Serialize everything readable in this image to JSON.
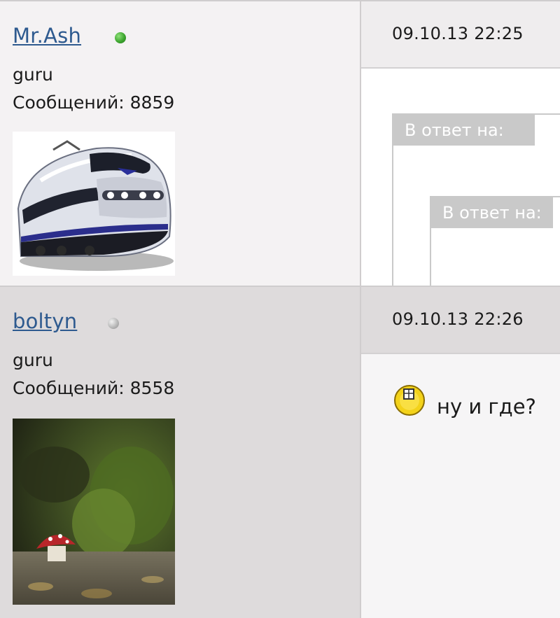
{
  "posts": [
    {
      "username": "Mr.Ash",
      "status": "online",
      "rank": "guru",
      "posts_count": "Сообщений: 8859",
      "avatar_icon": "train-avatar",
      "date": "09.10.13 22:25",
      "quote_label": "В ответ на:",
      "nested_quote_label": "В ответ на:"
    },
    {
      "username": "boltyn",
      "status": "offline",
      "rank": "guru",
      "posts_count": "Сообщений: 8558",
      "avatar_icon": "mushroom-photo-avatar",
      "date": "09.10.13 22:26",
      "smiley_icon": "smiley-icon",
      "message": "ну и где?"
    }
  ],
  "colors": {
    "link": "#2e5a8f",
    "online": "#3da52f",
    "offline": "#b9b9b9",
    "quote_header": "#c9c9c9"
  }
}
